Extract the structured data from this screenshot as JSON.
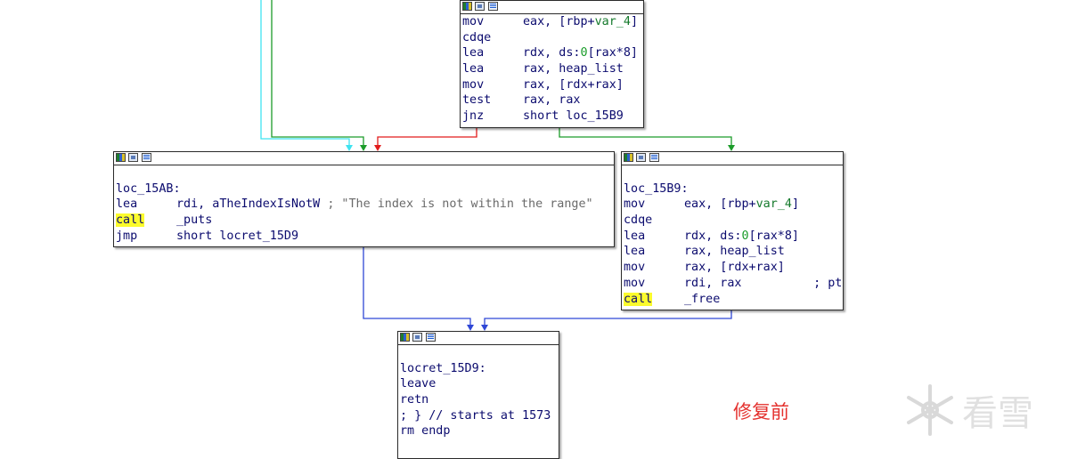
{
  "nodes": {
    "top": {
      "lines": [
        {
          "m": "mov",
          "o": [
            {
              "t": "eax, [rbp+"
            },
            {
              "t": "var_4",
              "c": "sym"
            },
            {
              "t": "]"
            }
          ]
        },
        {
          "m": "cdqe",
          "o": []
        },
        {
          "m": "lea",
          "o": [
            {
              "t": "rdx, ds:"
            },
            {
              "t": "0",
              "c": "num"
            },
            {
              "t": "[rax*8]"
            }
          ]
        },
        {
          "m": "lea",
          "o": [
            {
              "t": "rax, heap_list"
            }
          ]
        },
        {
          "m": "mov",
          "o": [
            {
              "t": "rax, [rdx+rax]"
            }
          ]
        },
        {
          "m": "test",
          "o": [
            {
              "t": "rax, rax"
            }
          ]
        },
        {
          "m": "jnz",
          "o": [
            {
              "t": "short loc_15B9"
            }
          ]
        }
      ]
    },
    "left": {
      "lines": [
        {
          "blank": true
        },
        {
          "label": "loc_15AB:"
        },
        {
          "m": "lea",
          "o": [
            {
              "t": "rdi, aTheIndexIsNotW "
            },
            {
              "t": "; \"The index is not within the range\"",
              "c": "cmt"
            }
          ]
        },
        {
          "m": "call",
          "hl": true,
          "o": [
            {
              "t": "_puts"
            }
          ]
        },
        {
          "m": "jmp",
          "o": [
            {
              "t": "short locret_15D9"
            }
          ]
        }
      ]
    },
    "right": {
      "lines": [
        {
          "blank": true
        },
        {
          "label": "loc_15B9:"
        },
        {
          "m": "mov",
          "o": [
            {
              "t": "eax, [rbp+"
            },
            {
              "t": "var_4",
              "c": "sym"
            },
            {
              "t": "]"
            }
          ]
        },
        {
          "m": "cdqe",
          "o": []
        },
        {
          "m": "lea",
          "o": [
            {
              "t": "rdx, ds:"
            },
            {
              "t": "0",
              "c": "num"
            },
            {
              "t": "[rax*8]"
            }
          ]
        },
        {
          "m": "lea",
          "o": [
            {
              "t": "rax, heap_list"
            }
          ]
        },
        {
          "m": "mov",
          "o": [
            {
              "t": "rax, [rdx+rax]"
            }
          ]
        },
        {
          "m": "mov",
          "o": [
            {
              "t": "rdi, rax          ; ptr"
            }
          ]
        },
        {
          "m": "call",
          "hl": true,
          "o": [
            {
              "t": "_free"
            }
          ]
        }
      ]
    },
    "bottom": {
      "lines": [
        {
          "blank": true
        },
        {
          "label": "locret_15D9:"
        },
        {
          "label": "leave"
        },
        {
          "label": "retn"
        },
        {
          "label": "; } // starts at 1573"
        },
        {
          "label": "rm endp"
        }
      ]
    }
  },
  "watermark": {
    "caption": "修复前",
    "logo_text": "看雪"
  },
  "colors": {
    "edge_true": "#1c9c2a",
    "edge_false": "#e21c1c",
    "edge_uncond": "#2f47d6",
    "edge_back": "#3fe3f0",
    "highlight": "#fbfb2c"
  }
}
